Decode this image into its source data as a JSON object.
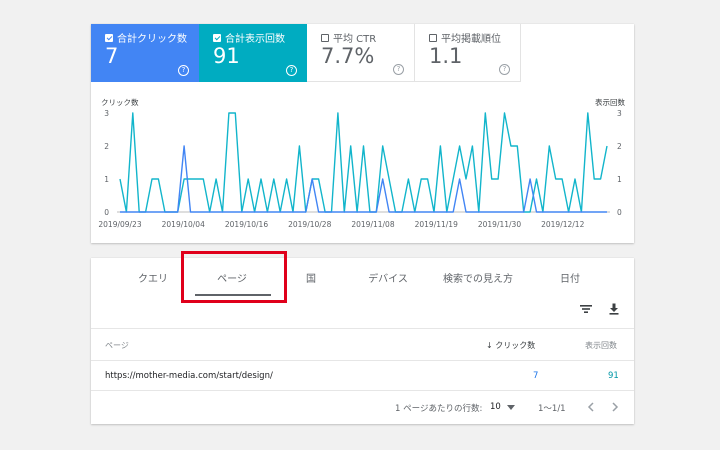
{
  "metrics": [
    {
      "label": "合計クリック数",
      "value": "7",
      "checked": true
    },
    {
      "label": "合計表示回数",
      "value": "91",
      "checked": true
    },
    {
      "label": "平均 CTR",
      "value": "7.7%",
      "checked": false
    },
    {
      "label": "平均掲載順位",
      "value": "1.1",
      "checked": false
    }
  ],
  "help_glyph": "?",
  "chart_data": {
    "type": "line",
    "ylabel_left": "クリック数",
    "ylabel_right": "表示回数",
    "yticks": [
      0,
      1,
      2,
      3
    ],
    "ylim": [
      0,
      3
    ],
    "xtick_labels": [
      "2019/09/23",
      "2019/10/04",
      "2019/10/16",
      "2019/10/28",
      "2019/11/08",
      "2019/11/19",
      "2019/11/30",
      "2019/12/12"
    ],
    "series": [
      {
        "name": "表示回数",
        "color": "#12b5cb",
        "values": [
          1,
          0,
          3,
          0,
          0,
          1,
          1,
          0,
          0,
          0,
          1,
          1,
          1,
          1,
          0,
          1,
          0,
          3,
          3,
          0,
          1,
          0,
          1,
          0,
          1,
          0,
          1,
          0,
          2,
          0,
          1,
          1,
          0,
          0,
          3,
          0,
          2,
          0,
          2,
          0,
          0,
          2,
          1,
          0,
          0,
          1,
          0,
          1,
          1,
          0,
          2,
          0,
          1,
          2,
          1,
          2,
          0,
          3,
          1,
          1,
          3,
          2,
          2,
          0,
          0,
          1,
          0,
          2,
          1,
          1,
          0,
          1,
          0,
          3,
          1,
          1,
          2
        ]
      },
      {
        "name": "クリック数",
        "color": "#4285f4",
        "values": [
          0,
          0,
          0,
          0,
          0,
          0,
          0,
          0,
          0,
          0,
          2,
          0,
          0,
          0,
          0,
          0,
          0,
          0,
          0,
          0,
          0,
          0,
          0,
          0,
          0,
          0,
          0,
          0,
          0,
          0,
          1,
          0,
          0,
          0,
          0,
          0,
          0,
          0,
          0,
          0,
          0,
          1,
          0,
          0,
          0,
          0,
          0,
          0,
          0,
          0,
          0,
          0,
          0,
          1,
          0,
          0,
          0,
          0,
          0,
          0,
          0,
          0,
          0,
          0,
          1,
          0,
          0,
          0,
          0,
          0,
          0,
          0,
          0,
          0,
          0,
          0,
          0
        ]
      }
    ]
  },
  "tabs": [
    "クエリ",
    "ページ",
    "国",
    "デバイス",
    "検索での見え方",
    "日付"
  ],
  "table": {
    "headers": {
      "page": "ページ",
      "clicks": "クリック数",
      "impressions": "表示回数"
    },
    "sort_arrow": "↓",
    "rows": [
      {
        "page": "https://mother-media.com/start/design/",
        "clicks": "7",
        "impressions": "91"
      }
    ]
  },
  "pagination": {
    "rows_label": "1 ページあたりの行数:",
    "rows_value": "10",
    "range": "1〜1/1"
  },
  "colors": {
    "clicks": "#4285f4",
    "impressions": "#00acc1",
    "highlight": "#e0001b"
  }
}
